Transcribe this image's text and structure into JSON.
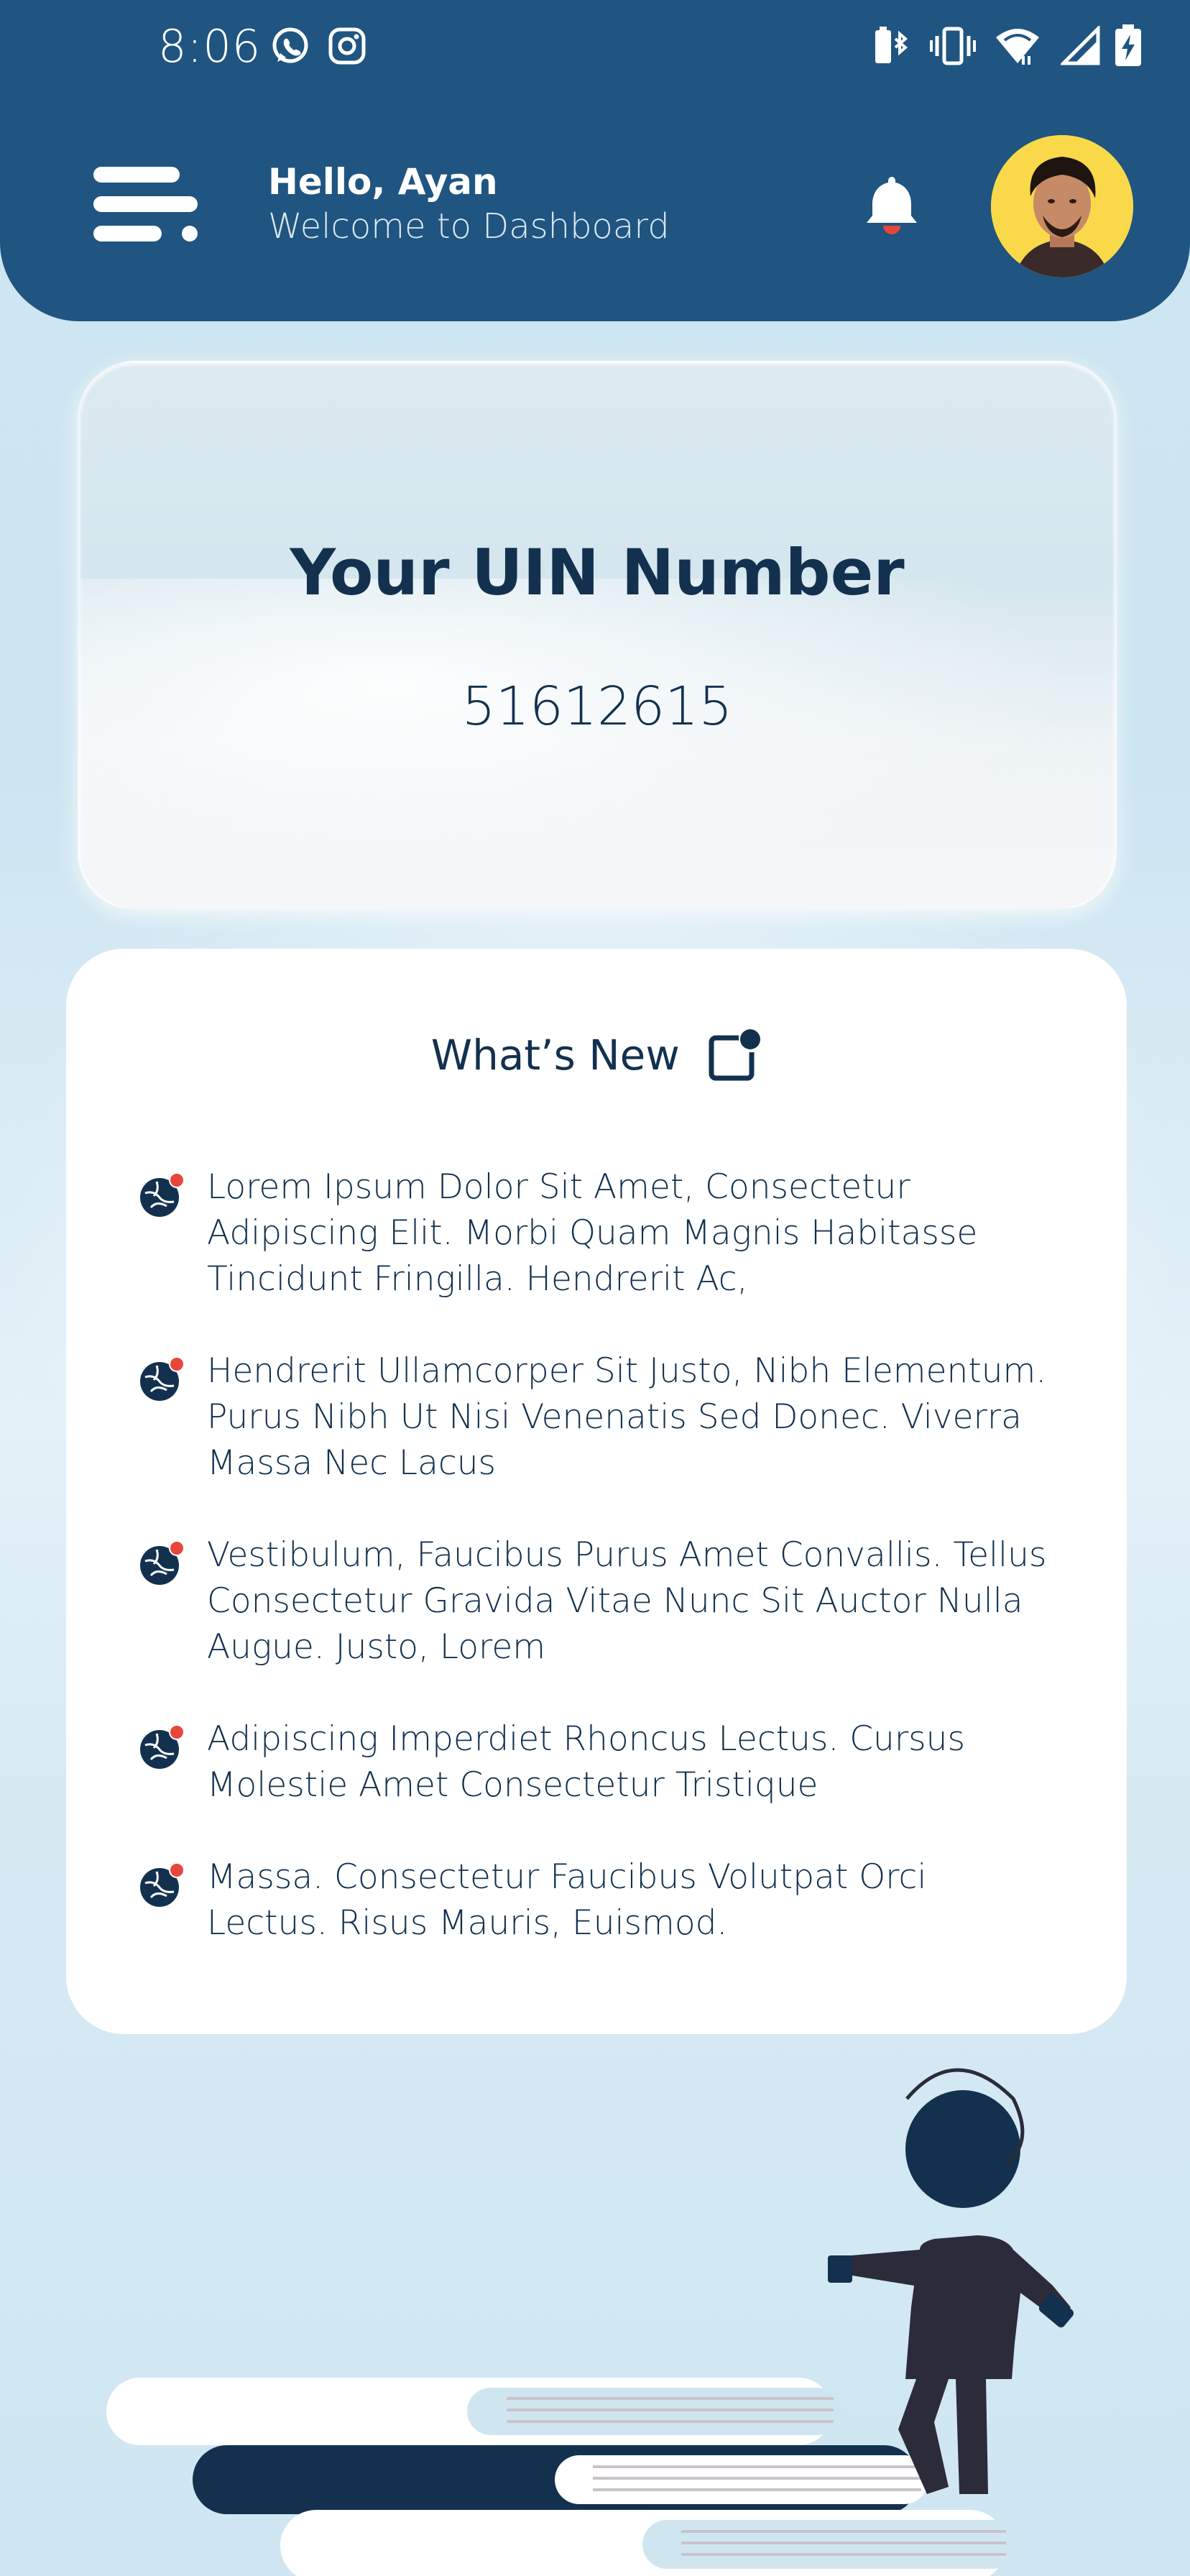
{
  "status_bar": {
    "time": "8:06",
    "left_icons": [
      "whatsapp-icon",
      "instagram-icon"
    ],
    "right_icons": [
      "bluetooth-battery-icon",
      "vibrate-icon",
      "wifi-icon",
      "signal-icon",
      "battery-charging-icon"
    ]
  },
  "header": {
    "greeting": "Hello, Ayan",
    "subtitle": "Welcome to Dashboard",
    "background_color": "#1f5580"
  },
  "uin": {
    "title": "Your UIN Number",
    "number": "51612615"
  },
  "news": {
    "title": "What’s New",
    "items": [
      {
        "text": "Lorem Ipsum Dolor Sit Amet, Consectetur Adipiscing Elit. Morbi Quam Magnis Habitasse Tincidunt Fringilla. Hendrerit Ac,"
      },
      {
        "text": "Hendrerit Ullamcorper Sit Justo, Nibh Elementum. Purus Nibh Ut Nisi Venenatis Sed Donec. Viverra Massa Nec Lacus"
      },
      {
        "text": " Vestibulum, Faucibus Purus Amet Convallis. Tellus Consectetur Gravida Vitae Nunc Sit Auctor Nulla Augue. Justo, Lorem"
      },
      {
        "text": " Adipiscing Imperdiet Rhoncus Lectus. Cursus Molestie Amet Consectetur Tristique"
      },
      {
        "text": " Massa. Consectetur Faucibus Volutpat Orci Lectus. Risus Mauris, Euismod."
      }
    ]
  },
  "colors": {
    "primary_dark": "#13314f",
    "accent_red": "#e5483b",
    "avatar_bg": "#f9d94a"
  }
}
